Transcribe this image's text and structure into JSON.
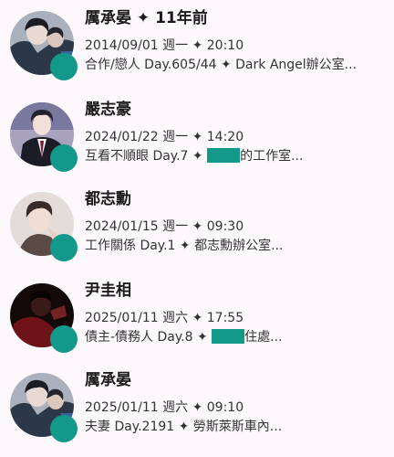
{
  "chats": [
    {
      "name": "厲承晏",
      "name_suffix": "✦ 11年前",
      "date": "2014/09/01 週一 ✦ 20:10",
      "detail": "合作/戀人 Day.605/44 ✦ Dark Angel辦公室...",
      "detail_after": "",
      "avatar_colors": [
        "#2c3848",
        "#aab1bd"
      ]
    },
    {
      "name": "嚴志豪",
      "name_suffix": "",
      "date": "2024/01/22 週一 ✦ 14:20",
      "detail": "互看不順眼 Day.7 ✦ ",
      "detail_after": "的工作室...",
      "avatar_colors": [
        "#6d6d8c",
        "#c9c6d6"
      ]
    },
    {
      "name": "都志勳",
      "name_suffix": "",
      "date": "2024/01/15 週一 ✦ 09:30",
      "detail": "工作關係 Day.1 ✦ 都志勳辦公室...",
      "detail_after": "",
      "avatar_colors": [
        "#4b3c38",
        "#e3dcd8"
      ]
    },
    {
      "name": "尹圭相",
      "name_suffix": "",
      "date": "2025/01/11 週六 ✦ 17:55",
      "detail": "債主-債務人 Day.8 ✦ ",
      "detail_after": "住處...",
      "avatar_colors": [
        "#1a0d0d",
        "#7a1a1f"
      ]
    },
    {
      "name": "厲承晏",
      "name_suffix": "",
      "date": "2025/01/11 週六 ✦ 09:10",
      "detail": "夫妻 Day.2191 ✦ 勞斯萊斯車內...",
      "detail_after": "",
      "avatar_colors": [
        "#2c3848",
        "#aab1bd"
      ]
    }
  ]
}
